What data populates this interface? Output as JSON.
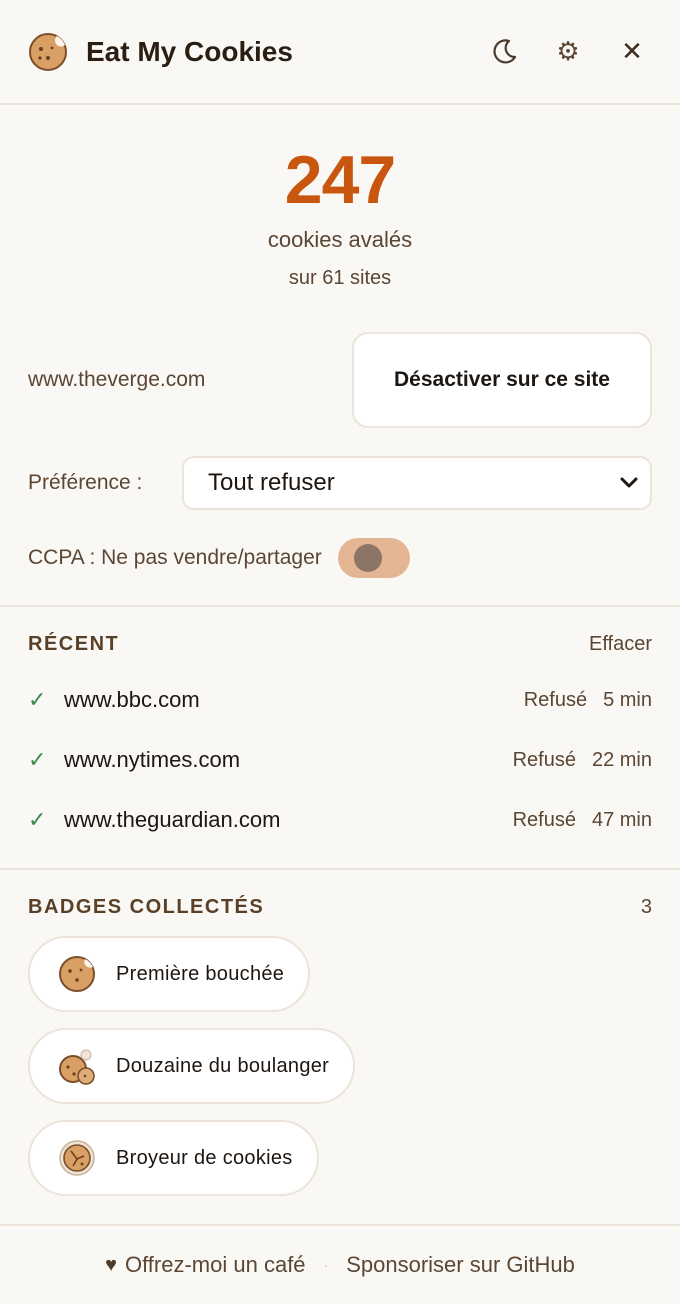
{
  "header": {
    "title": "Eat My Cookies",
    "logo_icon": "cookie-icon",
    "theme_icon": "moon-icon",
    "settings_icon": "gear-icon",
    "close_icon": "close-icon",
    "close_glyph": "✕",
    "settings_glyph": "⚙"
  },
  "stats": {
    "count": "247",
    "count_label": "cookies avalés",
    "sites_label": "sur 61 sites"
  },
  "site": {
    "domain": "www.theverge.com",
    "disable_label": "Désactiver sur ce site"
  },
  "preference": {
    "label": "Préférence :",
    "selected": "Tout refuser"
  },
  "ccpa": {
    "label": "CCPA : Ne pas vendre/partager",
    "enabled": false
  },
  "recent": {
    "title": "RÉCENT",
    "clear_label": "Effacer",
    "check_glyph": "✓",
    "items": [
      {
        "domain": "www.bbc.com",
        "status": "Refusé",
        "time": "5 min"
      },
      {
        "domain": "www.nytimes.com",
        "status": "Refusé",
        "time": "22 min"
      },
      {
        "domain": "www.theguardian.com",
        "status": "Refusé",
        "time": "47 min"
      }
    ]
  },
  "badges": {
    "title": "BADGES COLLECTÉS",
    "count": "3",
    "items": [
      {
        "label": "Première bouchée",
        "icon": "cookie-bite-icon"
      },
      {
        "label": "Douzaine du boulanger",
        "icon": "cookie-stack-icon"
      },
      {
        "label": "Broyeur de cookies",
        "icon": "cookie-crumble-icon"
      }
    ]
  },
  "footer": {
    "coffee_label": "Offrez-moi un café",
    "heart_glyph": "♥",
    "separator": "·",
    "github_label": "Sponsoriser sur GitHub"
  },
  "colors": {
    "accent": "#c9560e",
    "background": "#faf8f5",
    "check": "#3d8a4a",
    "toggle_track": "#e4b592"
  }
}
